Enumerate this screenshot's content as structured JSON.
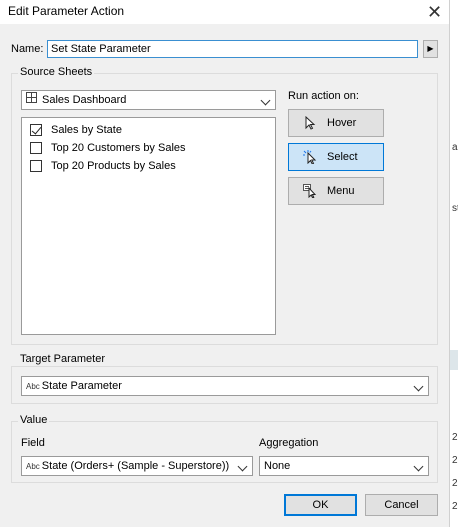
{
  "window": {
    "title": "Edit Parameter Action",
    "close_glyph": "✕"
  },
  "name": {
    "label": "Name:",
    "value": "Set State Parameter",
    "arrow_icon": "triangle-right-icon"
  },
  "source_sheets": {
    "group_title": "Source Sheets",
    "dashboard_select": "Sales Dashboard",
    "dashboard_icon": "grid-icon",
    "sheets": [
      {
        "label": "Sales by State",
        "checked": true
      },
      {
        "label": "Top 20 Customers by Sales",
        "checked": false
      },
      {
        "label": "Top 20 Products by Sales",
        "checked": false
      }
    ]
  },
  "run_action": {
    "label": "Run action on:",
    "buttons": [
      {
        "label": "Hover",
        "icon": "pointer-icon",
        "selected": false
      },
      {
        "label": "Select",
        "icon": "click-pointer-icon",
        "selected": true
      },
      {
        "label": "Menu",
        "icon": "menu-pointer-icon",
        "selected": false
      }
    ]
  },
  "target_parameter": {
    "group_title": "Target Parameter",
    "type_tag": "Abc",
    "value": "State Parameter"
  },
  "value_section": {
    "group_title": "Value",
    "field_label": "Field",
    "field_type_tag": "Abc",
    "field_value": "State (Orders+ (Sample - Superstore))",
    "aggregation_label": "Aggregation",
    "aggregation_value": "None"
  },
  "footer": {
    "ok_label": "OK",
    "cancel_label": "Cancel"
  },
  "background_fragments": {
    "bits": [
      "ar",
      "ste",
      "2",
      "2",
      "2",
      "2"
    ]
  },
  "colors": {
    "accent": "#0078d7",
    "selected_bg": "#cce4f7",
    "dialog_bg": "#f0f0f0"
  }
}
